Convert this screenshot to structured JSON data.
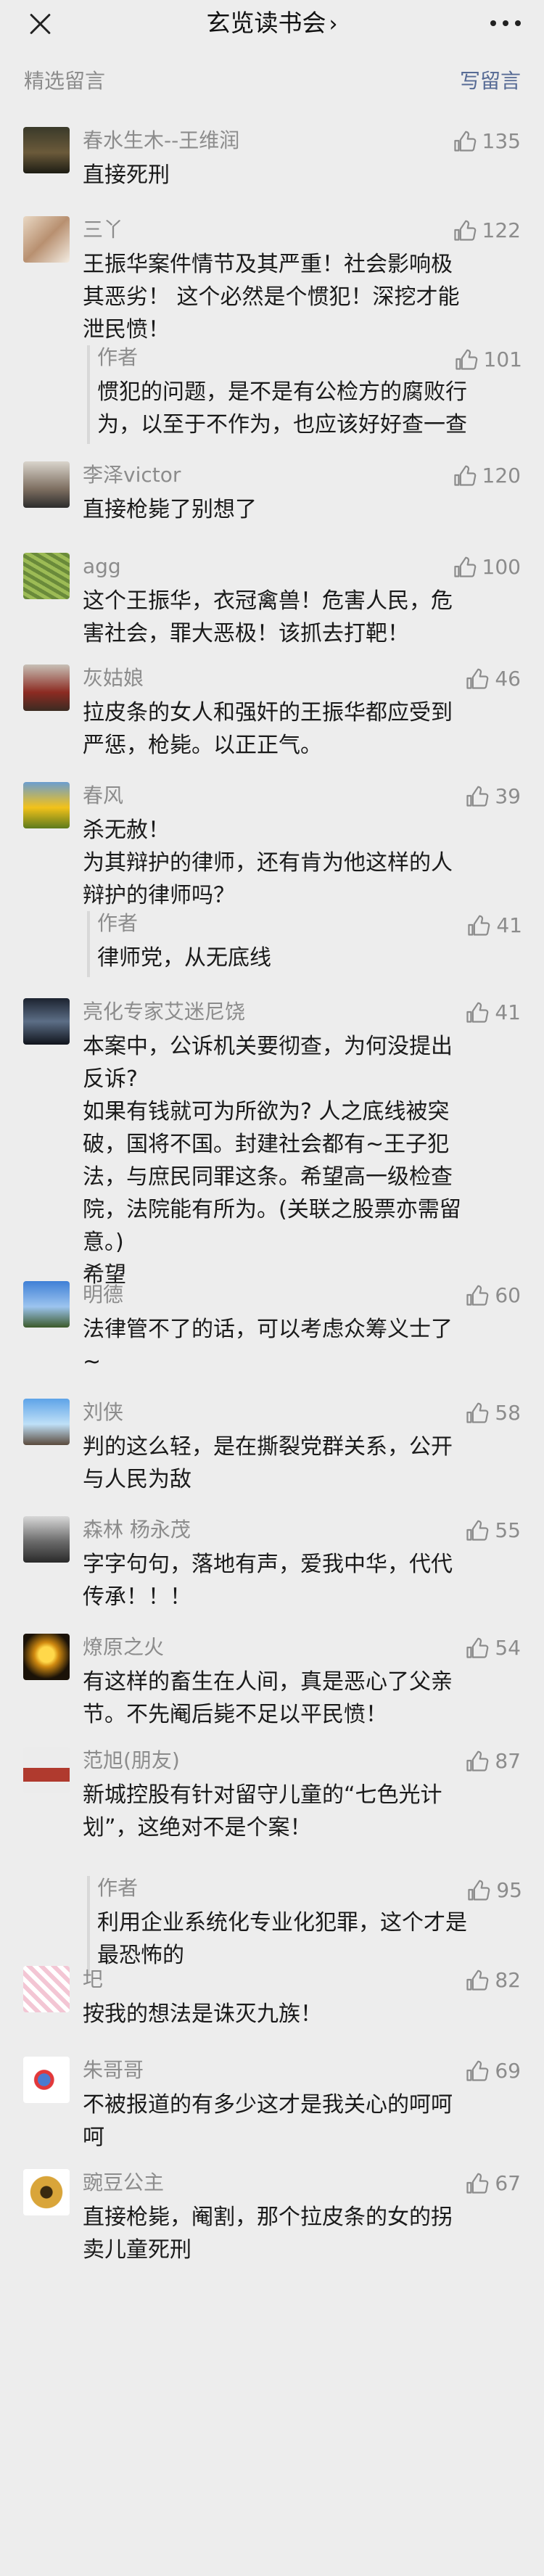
{
  "header": {
    "title": "玄览读书会",
    "chevron": "›"
  },
  "section": {
    "left_label": "精选留言",
    "right_label": "写留言"
  },
  "colors": {
    "link_blue": "#576b95",
    "muted_gray": "#8c8c8c",
    "bg": "#ededed"
  },
  "comments": [
    {
      "nickname": "春水生木--王维润",
      "likes": "135",
      "lines": [
        "直接死刑"
      ],
      "avatar": "dark-landscape"
    },
    {
      "nickname": "三丫",
      "likes": "122",
      "lines": [
        "王振华案件情节及其严重！社会影响极",
        "其恶劣！ 这个必然是个惯犯！深挖才能",
        "泄民愤！"
      ],
      "avatar": "girl-photo",
      "reply": {
        "author": "作者",
        "likes": "101",
        "lines": [
          "惯犯的问题，是不是有公检方的腐败行",
          "为，以至于不作为，也应该好好查一查"
        ]
      }
    },
    {
      "nickname": "李泽victor",
      "likes": "120",
      "lines": [
        "直接枪毙了别想了"
      ],
      "avatar": "man-portrait"
    },
    {
      "nickname": "agg",
      "likes": "100",
      "lines": [
        "这个王振华，衣冠禽兽！危害人民，危",
        "害社会，罪大恶极！该抓去打靶！"
      ],
      "avatar": "green-field"
    },
    {
      "nickname": "灰姑娘",
      "likes": "46",
      "lines": [
        "拉皮条的女人和强奸的王振华都应受到",
        "严惩，枪毙。以正正气。"
      ],
      "avatar": "red-figure"
    },
    {
      "nickname": "春风",
      "likes": "39",
      "lines": [
        "杀无赦！",
        "为其辩护的律师，还有肯为他这样的人",
        "辩护的律师吗？"
      ],
      "avatar": "sunflowers",
      "reply": {
        "author": "作者",
        "likes": "41",
        "lines": [
          "律师党，从无底线"
        ]
      }
    },
    {
      "nickname": "亮化专家艾迷尼饶",
      "likes": "41",
      "lines": [
        "本案中，公诉机关要彻查，为何没提出",
        "反诉?",
        "如果有钱就可为所欲为? 人之底线被突",
        "破，国将不国。封建社会都有~王子犯",
        "法，与庶民同罪这条。希望高一级检查",
        "院，法院能有所为。(关联之股票亦需留",
        "意。)",
        "希望"
      ],
      "avatar": "night-city"
    },
    {
      "nickname": "明德",
      "likes": "60",
      "lines": [
        "法律管不了的话，可以考虑众筹义士了",
        "~"
      ],
      "avatar": "blue-sky"
    },
    {
      "nickname": "刘侠",
      "likes": "58",
      "lines": [
        "判的这么轻，是在撕裂党群关系，公开",
        "与人民为敌"
      ],
      "avatar": "man-sky"
    },
    {
      "nickname": "森林 杨永茂",
      "likes": "55",
      "lines": [
        "字字句句，落地有声，爱我中华，代代",
        "传承！！！"
      ],
      "avatar": "bw-portrait"
    },
    {
      "nickname": "燎原之火",
      "likes": "54",
      "lines": [
        "有这样的畜生在人间，真是恶心了父亲",
        "节。不先阉后毙不足以平民愤！"
      ],
      "avatar": "fire"
    },
    {
      "nickname": "范旭(朋友)",
      "likes": "87",
      "lines": [
        "新城控股有针对留守儿童的“七色光计",
        "划”，这绝对不是个案！"
      ],
      "avatar": "photo-strip",
      "reply": {
        "author": "作者",
        "likes": "95",
        "lines": [
          "利用企业系统化专业化犯罪，这个才是",
          "最恐怖的"
        ]
      }
    },
    {
      "nickname": "圯",
      "likes": "82",
      "lines": [
        "按我的想法是诛灭九族！"
      ],
      "avatar": "pink-pattern"
    },
    {
      "nickname": "朱哥哥",
      "likes": "69",
      "lines": [
        "不被报道的有多少这才是我关心的呵呵",
        "呵"
      ],
      "avatar": "bird-drawing"
    },
    {
      "nickname": "豌豆公主",
      "likes": "67",
      "lines": [
        "直接枪毙，阉割，那个拉皮条的女的拐",
        "卖儿童死刑"
      ],
      "avatar": "gold-circle"
    }
  ]
}
